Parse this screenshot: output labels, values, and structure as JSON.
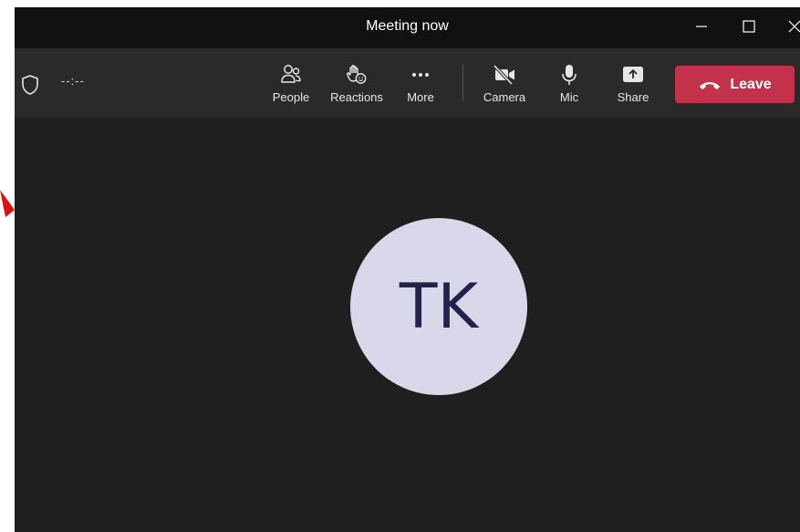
{
  "window": {
    "title": "Meeting now"
  },
  "toolbar": {
    "timer": "--:--",
    "buttons": {
      "people": "People",
      "reactions": "Reactions",
      "more": "More",
      "camera": "Camera",
      "mic": "Mic",
      "share": "Share"
    },
    "leave_label": "Leave"
  },
  "participant": {
    "initials": "TK"
  },
  "icons": {
    "security": "shield-icon",
    "people": "people-icon",
    "reactions": "reaction-hand-icon",
    "more": "more-dots-icon",
    "camera": "camera-off-icon",
    "mic": "microphone-icon",
    "share": "share-tray-icon",
    "leave": "hang-up-phone-icon",
    "minimize": "minimize-icon",
    "maximize": "maximize-icon",
    "close": "close-icon"
  },
  "colors": {
    "titlebar": "#111111",
    "toolbar": "#2a2a2a",
    "stage": "#1f1f1f",
    "leave_button": "#c4314b",
    "avatar_bg": "#d9d7ea",
    "avatar_text": "#24214a",
    "annotation_arrow": "#e01010"
  }
}
